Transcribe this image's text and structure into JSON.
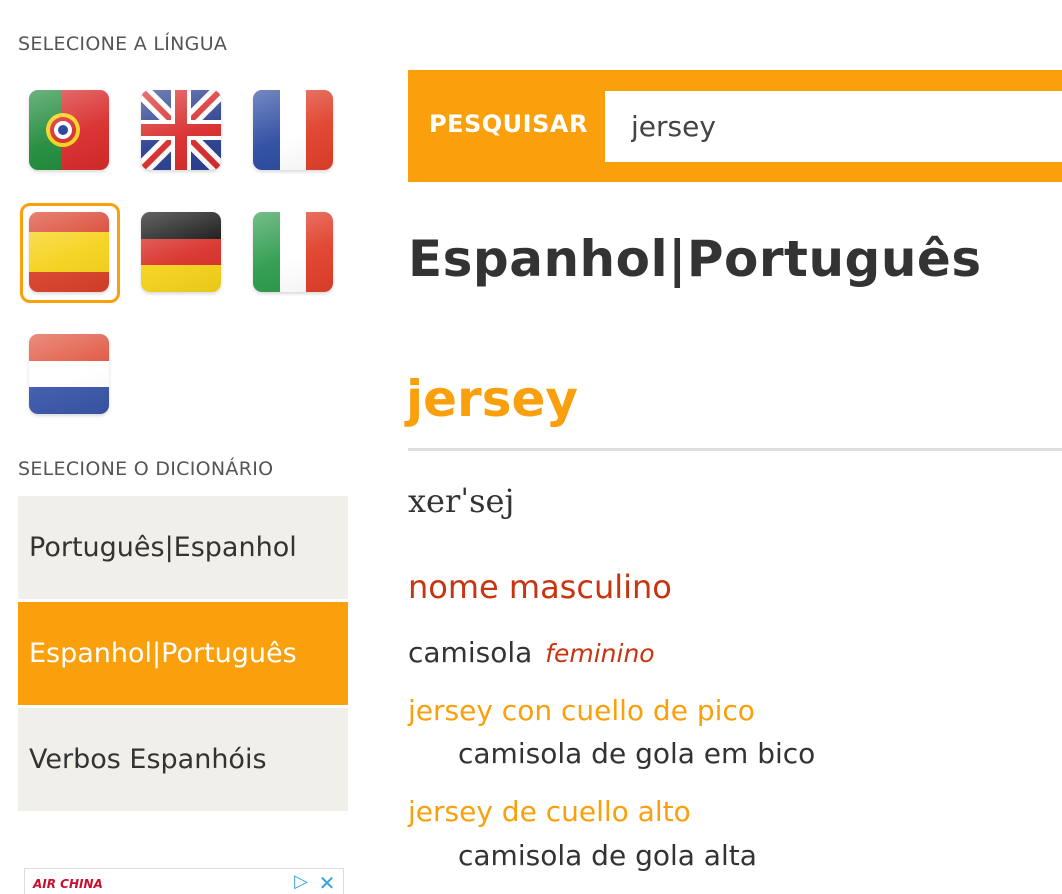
{
  "sidebar": {
    "language_label": "SELECIONE A LÍNGUA",
    "languages": [
      {
        "name": "portuguese-flag-icon",
        "selected": false
      },
      {
        "name": "uk-flag-icon",
        "selected": false
      },
      {
        "name": "france-flag-icon",
        "selected": false
      },
      {
        "name": "spain-flag-icon",
        "selected": true
      },
      {
        "name": "germany-flag-icon",
        "selected": false
      },
      {
        "name": "italy-flag-icon",
        "selected": false
      },
      {
        "name": "netherlands-flag-icon",
        "selected": false
      }
    ],
    "dictionary_label": "SELECIONE O DICIONÁRIO",
    "dictionaries": [
      {
        "label": "Português|Espanhol",
        "active": false
      },
      {
        "label": "Espanhol|Português",
        "active": true
      },
      {
        "label": "Verbos Espanhóis",
        "active": false
      }
    ],
    "ad": {
      "logo_text": "AIR CHINA"
    }
  },
  "search": {
    "label": "PESQUISAR",
    "value": "jersey"
  },
  "main": {
    "dictionary_title": "Espanhol|Português",
    "headword": "jersey",
    "phonetic": "xerˈsej",
    "part_of_speech": "nome masculino",
    "translation": "camisola",
    "gender": "feminino",
    "examples": [
      {
        "phrase": "jersey con cuello de pico",
        "translation": "camisola de gola em bico"
      },
      {
        "phrase": "jersey de cuello alto",
        "translation": "camisola de gola alta"
      }
    ]
  },
  "colors": {
    "accent": "#f9a00c",
    "pos_red": "#c8340f",
    "panel_bg": "#f1efea",
    "text": "#333333"
  }
}
